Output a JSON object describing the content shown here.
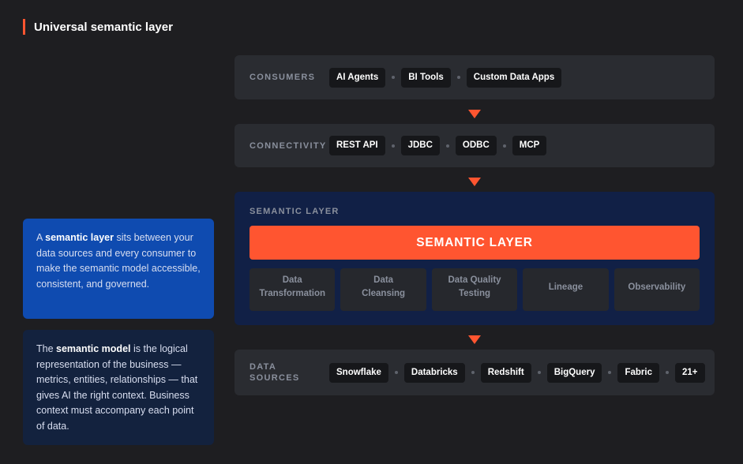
{
  "title": "Universal semantic layer",
  "cards": {
    "top": {
      "pre": "A ",
      "bold": "semantic layer",
      "post": " sits between your data sources and every consumer to make the semantic model accessible, consistent, and governed."
    },
    "bottom": {
      "pre": "The ",
      "bold": "semantic model",
      "post": " is the logical representation of the business — metrics, entities, relationships — that gives AI the right context. Business context must accompany each point of data."
    }
  },
  "consumers": {
    "label": "CONSUMERS",
    "chips": [
      "AI Agents",
      "BI Tools",
      "Custom Data Apps"
    ]
  },
  "connectivity": {
    "label": "CONNECTIVITY",
    "chips": [
      "REST API",
      "JDBC",
      "ODBC",
      "MCP"
    ]
  },
  "semantic_layer": {
    "label": "SEMANTIC LAYER",
    "bar": "SEMANTIC LAYER",
    "subs": [
      "Data\nTransformation",
      "Data\nCleansing",
      "Data Quality\nTesting",
      "Lineage",
      "Observability"
    ]
  },
  "data_sources": {
    "label": "DATA SOURCES",
    "chips": [
      "Snowflake",
      "Databricks",
      "Redshift",
      "BigQuery",
      "Fabric",
      "21+"
    ]
  },
  "colors": {
    "accent": "#ff5530",
    "background": "#1e1e21",
    "row": "#2a2c31",
    "semantic_panel": "#112046",
    "card_blue": "#0f4bb0",
    "card_navy": "#13223e"
  }
}
